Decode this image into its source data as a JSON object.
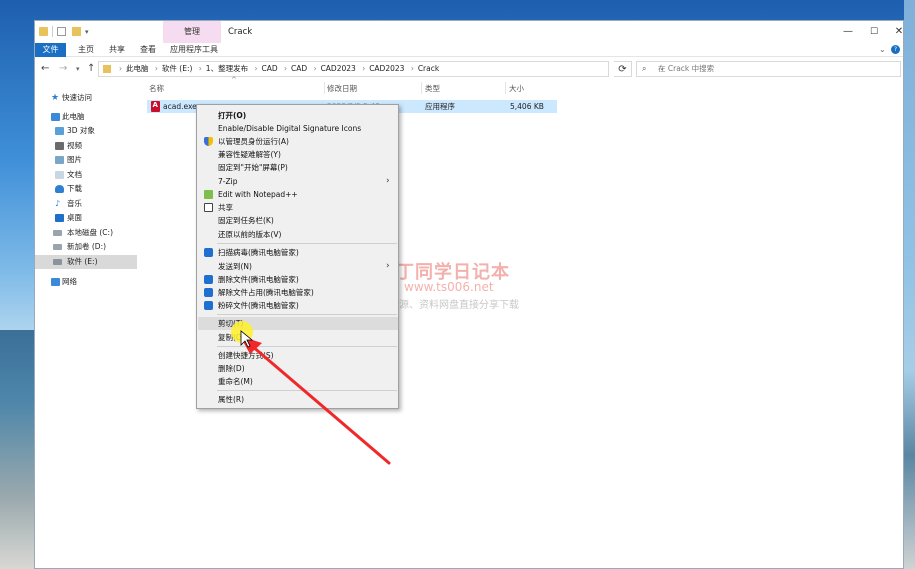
{
  "window": {
    "manage_tab": "管理",
    "title": "Crack",
    "min": "—",
    "max": "☐",
    "close": "✕"
  },
  "ribbon": {
    "tabs": [
      "文件",
      "主页",
      "共享",
      "查看",
      "应用程序工具"
    ],
    "expand": "⌄",
    "help": "?"
  },
  "address": {
    "crumbs": [
      "此电脑",
      "软件 (E:)",
      "1、整理发布",
      "CAD",
      "CAD",
      "CAD2023",
      "CAD2023",
      "Crack"
    ],
    "search_placeholder": "在 Crack 中搜索"
  },
  "nav_pane": {
    "items": [
      "快速访问",
      "此电脑",
      "3D 对象",
      "视频",
      "图片",
      "文档",
      "下载",
      "音乐",
      "桌面",
      "本地磁盘 (C:)",
      "新加卷 (D:)",
      "软件 (E:)",
      "网络"
    ]
  },
  "columns": [
    "名称",
    "修改日期",
    "类型",
    "大小"
  ],
  "file": {
    "name": "acad.exe",
    "date": "2022/2/9 5:48",
    "type": "应用程序",
    "size": "5,406 KB"
  },
  "context_menu": {
    "items": [
      "打开(O)",
      "Enable/Disable Digital Signature Icons",
      "以管理员身份运行(A)",
      "兼容性疑难解答(Y)",
      "固定到\"开始\"屏幕(P)",
      "7-Zip",
      "Edit with Notepad++",
      "共享",
      "固定到任务栏(K)",
      "还原以前的版本(V)",
      "扫描病毒(腾讯电脑管家)",
      "发送到(N)",
      "删除文件(腾讯电脑管家)",
      "解除文件占用(腾讯电脑管家)",
      "粉碎文件(腾讯电脑管家)",
      "剪切(T)",
      "复制(C)",
      "创建快捷方式(S)",
      "删除(D)",
      "重命名(M)",
      "属性(R)"
    ],
    "submenu_arrow": "›"
  },
  "watermark": {
    "line1": "丁同学日记本",
    "line2": "www.ts006.net",
    "line3": "软件、资源、资料网盘直接分享下载"
  },
  "colors": {
    "accent": "#1a6fc4",
    "selection": "#cce8ff",
    "annotation_arrow": "#f0282a",
    "cursor_highlight": "#fff028"
  },
  "icons": {
    "quick_access": "star-icon",
    "pc": "computer-icon",
    "network": "network-icon",
    "file": "autocad-icon"
  }
}
